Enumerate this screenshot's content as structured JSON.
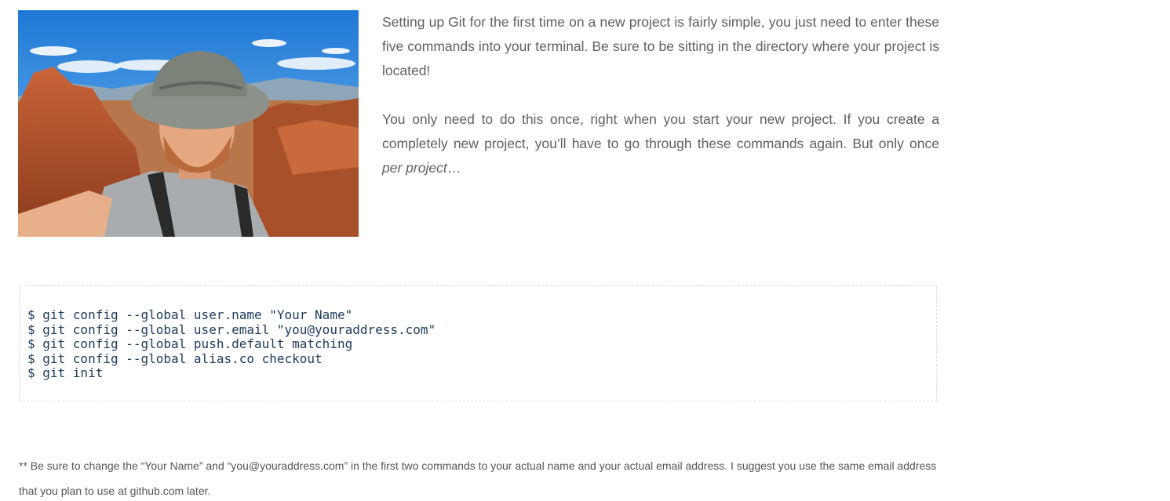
{
  "article": {
    "photo": {
      "alt": "Man wearing a bucket hat and sunglasses taking a selfie in a red rock desert"
    },
    "intro": {
      "paragraph_1": "Setting up Git for the first time on a new project is fairly simple, you just need to enter these five commands into your terminal. Be sure to be sitting in the directory where your project is located!",
      "paragraph_2_start": "You only need to do this once, right when you start your new project. If you create a completely new project, you’ll have to go through these commands again. But only once ",
      "paragraph_2_emphasis": "per project",
      "paragraph_2_end": "…"
    },
    "code": {
      "lines": [
        "$ git config --global user.name \"Your Name\"",
        "$ git config --global user.email \"you@youraddress.com\"",
        "$ git config --global push.default matching",
        "$ git config --global alias.co checkout",
        "$ git init"
      ]
    },
    "footnote": "** Be sure to change the “Your Name” and “you@youraddress.com” in the first two commands to your actual name and your actual email address. I suggest you use the same email address that you plan to use at github.com later."
  }
}
